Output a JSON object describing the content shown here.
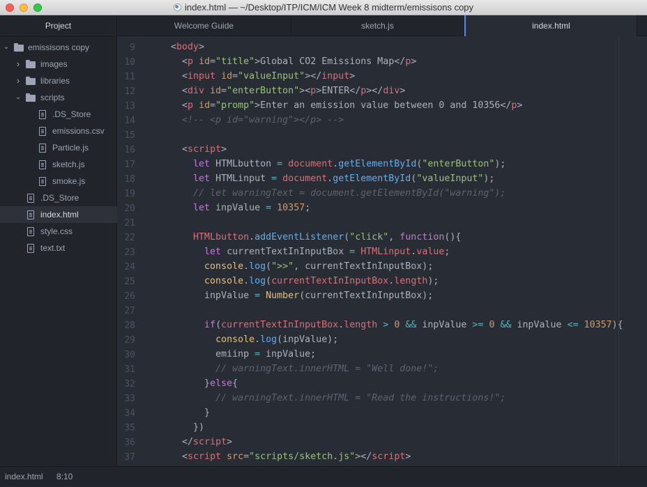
{
  "window": {
    "title": "index.html — ~/Desktop/ITP/ICM/ICM Week 8 midterm/emissisons copy"
  },
  "sidebar": {
    "header": "Project",
    "tree": [
      {
        "label": "emissisons copy",
        "type": "folder",
        "depth": 0,
        "expanded": true
      },
      {
        "label": "images",
        "type": "folder",
        "depth": 1,
        "expanded": false
      },
      {
        "label": "libraries",
        "type": "folder",
        "depth": 1,
        "expanded": false
      },
      {
        "label": "scripts",
        "type": "folder",
        "depth": 1,
        "expanded": true
      },
      {
        "label": ".DS_Store",
        "type": "file",
        "depth": 2
      },
      {
        "label": "emissions.csv",
        "type": "file",
        "depth": 2
      },
      {
        "label": "Particle.js",
        "type": "file",
        "depth": 2
      },
      {
        "label": "sketch.js",
        "type": "file",
        "depth": 2
      },
      {
        "label": "smoke.js",
        "type": "file",
        "depth": 2
      },
      {
        "label": ".DS_Store",
        "type": "file",
        "depth": 1
      },
      {
        "label": "index.html",
        "type": "file",
        "depth": 1,
        "selected": true
      },
      {
        "label": "style.css",
        "type": "file",
        "depth": 1
      },
      {
        "label": "text.txt",
        "type": "file",
        "depth": 1
      }
    ]
  },
  "tabs": [
    {
      "label": "Welcome Guide",
      "active": false
    },
    {
      "label": "sketch.js",
      "active": false
    },
    {
      "label": "index.html",
      "active": true
    }
  ],
  "colors": {
    "background": "#282c34",
    "text": "#abb2bf",
    "tag": "#e06c75",
    "attr": "#d19a66",
    "string": "#98c379",
    "keyword": "#c678dd",
    "function": "#61afef",
    "builtin": "#e5c07b",
    "operator": "#56b6c2",
    "comment": "#5c6370"
  },
  "editor": {
    "lines": [
      {
        "num": "9",
        "tokens": [
          [
            "  ",
            "t"
          ],
          [
            "<",
            "t"
          ],
          [
            "body",
            "tag"
          ],
          [
            ">",
            "t"
          ]
        ]
      },
      {
        "num": "10",
        "tokens": [
          [
            "    ",
            "t"
          ],
          [
            "<",
            "t"
          ],
          [
            "p",
            "tag"
          ],
          [
            " ",
            "t"
          ],
          [
            "id",
            "attr"
          ],
          [
            "=",
            "t"
          ],
          [
            "\"title\"",
            "string"
          ],
          [
            ">Global CO2 Emissions Map</",
            "t"
          ],
          [
            "p",
            "tag"
          ],
          [
            ">",
            "t"
          ]
        ]
      },
      {
        "num": "11",
        "tokens": [
          [
            "    ",
            "t"
          ],
          [
            "<",
            "t"
          ],
          [
            "input",
            "tag"
          ],
          [
            " ",
            "t"
          ],
          [
            "id",
            "attr"
          ],
          [
            "=",
            "t"
          ],
          [
            "\"valueInput\"",
            "string"
          ],
          [
            "></",
            "t"
          ],
          [
            "input",
            "tag"
          ],
          [
            ">",
            "t"
          ]
        ]
      },
      {
        "num": "12",
        "tokens": [
          [
            "    ",
            "t"
          ],
          [
            "<",
            "t"
          ],
          [
            "div",
            "tag"
          ],
          [
            " ",
            "t"
          ],
          [
            "id",
            "attr"
          ],
          [
            "=",
            "t"
          ],
          [
            "\"enterButton\"",
            "string"
          ],
          [
            "><",
            "t"
          ],
          [
            "p",
            "tag"
          ],
          [
            ">ENTER</",
            "t"
          ],
          [
            "p",
            "tag"
          ],
          [
            "></",
            "t"
          ],
          [
            "div",
            "tag"
          ],
          [
            ">",
            "t"
          ]
        ]
      },
      {
        "num": "13",
        "tokens": [
          [
            "    ",
            "t"
          ],
          [
            "<",
            "t"
          ],
          [
            "p",
            "tag"
          ],
          [
            " ",
            "t"
          ],
          [
            "id",
            "attr"
          ],
          [
            "=",
            "t"
          ],
          [
            "\"promp\"",
            "string"
          ],
          [
            ">Enter an emission value between 0 and 10356</",
            "t"
          ],
          [
            "p",
            "tag"
          ],
          [
            ">",
            "t"
          ]
        ]
      },
      {
        "num": "14",
        "tokens": [
          [
            "    ",
            "t"
          ],
          [
            "<!-- <p id=\"warning\"></p> -->",
            "comment"
          ]
        ]
      },
      {
        "num": "15",
        "tokens": [
          [
            "",
            "t"
          ]
        ]
      },
      {
        "num": "16",
        "tokens": [
          [
            "    ",
            "t"
          ],
          [
            "<",
            "t"
          ],
          [
            "script",
            "tag"
          ],
          [
            ">",
            "t"
          ]
        ]
      },
      {
        "num": "17",
        "tokens": [
          [
            "      ",
            "t"
          ],
          [
            "let",
            "keyword"
          ],
          [
            " HTMLbutton ",
            "t"
          ],
          [
            "=",
            "operator"
          ],
          [
            " ",
            "t"
          ],
          [
            "document",
            "tag"
          ],
          [
            ".",
            "t"
          ],
          [
            "getElementById",
            "function"
          ],
          [
            "(",
            "t"
          ],
          [
            "\"enterButton\"",
            "string"
          ],
          [
            ");",
            "t"
          ]
        ]
      },
      {
        "num": "18",
        "tokens": [
          [
            "      ",
            "t"
          ],
          [
            "let",
            "keyword"
          ],
          [
            " HTMLinput ",
            "t"
          ],
          [
            "=",
            "operator"
          ],
          [
            " ",
            "t"
          ],
          [
            "document",
            "tag"
          ],
          [
            ".",
            "t"
          ],
          [
            "getElementById",
            "function"
          ],
          [
            "(",
            "t"
          ],
          [
            "\"valueInput\"",
            "string"
          ],
          [
            ");",
            "t"
          ]
        ]
      },
      {
        "num": "19",
        "tokens": [
          [
            "      ",
            "t"
          ],
          [
            "// let warningText = document.getElementById(\"warning\");",
            "comment"
          ]
        ]
      },
      {
        "num": "20",
        "tokens": [
          [
            "      ",
            "t"
          ],
          [
            "let",
            "keyword"
          ],
          [
            " inpValue ",
            "t"
          ],
          [
            "=",
            "operator"
          ],
          [
            " ",
            "t"
          ],
          [
            "10357",
            "attr"
          ],
          [
            ";",
            "t"
          ]
        ]
      },
      {
        "num": "21",
        "tokens": [
          [
            "",
            "t"
          ]
        ]
      },
      {
        "num": "22",
        "tokens": [
          [
            "      ",
            "t"
          ],
          [
            "HTMLbutton",
            "tag"
          ],
          [
            ".",
            "t"
          ],
          [
            "addEventListener",
            "function"
          ],
          [
            "(",
            "t"
          ],
          [
            "\"click\"",
            "string"
          ],
          [
            ", ",
            "t"
          ],
          [
            "function",
            "keyword"
          ],
          [
            "(){",
            "t"
          ]
        ]
      },
      {
        "num": "23",
        "tokens": [
          [
            "        ",
            "t"
          ],
          [
            "let",
            "keyword"
          ],
          [
            " currentTextInInputBox ",
            "t"
          ],
          [
            "=",
            "operator"
          ],
          [
            " ",
            "t"
          ],
          [
            "HTMLinput",
            "tag"
          ],
          [
            ".",
            "t"
          ],
          [
            "value",
            "tag"
          ],
          [
            ";",
            "t"
          ]
        ]
      },
      {
        "num": "24",
        "tokens": [
          [
            "        ",
            "t"
          ],
          [
            "console",
            "builtin"
          ],
          [
            ".",
            "t"
          ],
          [
            "log",
            "function"
          ],
          [
            "(",
            "t"
          ],
          [
            "\">>\"",
            "string"
          ],
          [
            ", currentTextInInputBox);",
            "t"
          ]
        ]
      },
      {
        "num": "25",
        "tokens": [
          [
            "        ",
            "t"
          ],
          [
            "console",
            "builtin"
          ],
          [
            ".",
            "t"
          ],
          [
            "log",
            "function"
          ],
          [
            "(",
            "t"
          ],
          [
            "currentTextInInputBox",
            "tag"
          ],
          [
            ".",
            "t"
          ],
          [
            "length",
            "tag"
          ],
          [
            ");",
            "t"
          ]
        ]
      },
      {
        "num": "26",
        "tokens": [
          [
            "        ",
            "t"
          ],
          [
            "inpValue ",
            "t"
          ],
          [
            "=",
            "operator"
          ],
          [
            " ",
            "t"
          ],
          [
            "Number",
            "builtin"
          ],
          [
            "(currentTextInInputBox);",
            "t"
          ]
        ]
      },
      {
        "num": "27",
        "tokens": [
          [
            "",
            "t"
          ]
        ]
      },
      {
        "num": "28",
        "tokens": [
          [
            "        ",
            "t"
          ],
          [
            "if",
            "keyword"
          ],
          [
            "(",
            "t"
          ],
          [
            "currentTextInInputBox",
            "tag"
          ],
          [
            ".",
            "t"
          ],
          [
            "length",
            "tag"
          ],
          [
            " ",
            "t"
          ],
          [
            ">",
            "operator"
          ],
          [
            " ",
            "t"
          ],
          [
            "0",
            "attr"
          ],
          [
            " ",
            "t"
          ],
          [
            "&&",
            "operator"
          ],
          [
            " inpValue ",
            "t"
          ],
          [
            ">=",
            "operator"
          ],
          [
            " ",
            "t"
          ],
          [
            "0",
            "attr"
          ],
          [
            " ",
            "t"
          ],
          [
            "&&",
            "operator"
          ],
          [
            " inpValue ",
            "t"
          ],
          [
            "<=",
            "operator"
          ],
          [
            " ",
            "t"
          ],
          [
            "10357",
            "attr"
          ],
          [
            "){",
            "t"
          ]
        ]
      },
      {
        "num": "29",
        "tokens": [
          [
            "          ",
            "t"
          ],
          [
            "console",
            "builtin"
          ],
          [
            ".",
            "t"
          ],
          [
            "log",
            "function"
          ],
          [
            "(inpValue);",
            "t"
          ]
        ]
      },
      {
        "num": "30",
        "tokens": [
          [
            "          ",
            "t"
          ],
          [
            "emiinp ",
            "t"
          ],
          [
            "=",
            "operator"
          ],
          [
            " inpValue;",
            "t"
          ]
        ]
      },
      {
        "num": "31",
        "tokens": [
          [
            "          ",
            "t"
          ],
          [
            "// warningText.innerHTML = \"Well done!\";",
            "comment"
          ]
        ]
      },
      {
        "num": "32",
        "tokens": [
          [
            "        ",
            "t"
          ],
          [
            "}",
            "t"
          ],
          [
            "else",
            "keyword"
          ],
          [
            "{",
            "t"
          ]
        ]
      },
      {
        "num": "33",
        "tokens": [
          [
            "          ",
            "t"
          ],
          [
            "// warningText.innerHTML = \"Read the instructions!\";",
            "comment"
          ]
        ]
      },
      {
        "num": "34",
        "tokens": [
          [
            "        ",
            "t"
          ],
          [
            "}",
            "t"
          ]
        ]
      },
      {
        "num": "35",
        "tokens": [
          [
            "      ",
            "t"
          ],
          [
            "})",
            "t"
          ]
        ]
      },
      {
        "num": "36",
        "tokens": [
          [
            "    ",
            "t"
          ],
          [
            "</",
            "t"
          ],
          [
            "script",
            "tag"
          ],
          [
            ">",
            "t"
          ]
        ]
      },
      {
        "num": "37",
        "tokens": [
          [
            "    ",
            "t"
          ],
          [
            "<",
            "t"
          ],
          [
            "script",
            "tag"
          ],
          [
            " ",
            "t"
          ],
          [
            "src",
            "attr"
          ],
          [
            "=",
            "t"
          ],
          [
            "\"scripts/sketch.js\"",
            "string"
          ],
          [
            "></",
            "t"
          ],
          [
            "script",
            "tag"
          ],
          [
            ">",
            "t"
          ]
        ]
      }
    ]
  },
  "status": {
    "file": "index.html",
    "cursor": "8:10"
  }
}
